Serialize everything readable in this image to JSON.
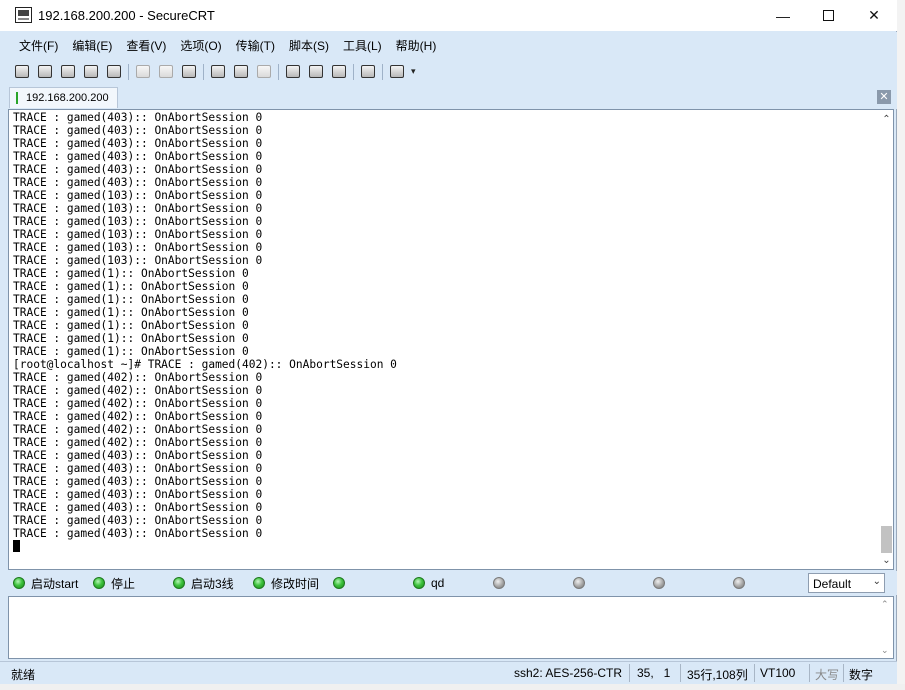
{
  "window": {
    "title": "192.168.200.200 - SecureCRT",
    "min_glyph": "—",
    "close_glyph": "✕"
  },
  "menu": [
    "文件(F)",
    "编辑(E)",
    "查看(V)",
    "选项(O)",
    "传输(T)",
    "脚本(S)",
    "工具(L)",
    "帮助(H)"
  ],
  "tab": {
    "label": "192.168.200.200",
    "close_glyph": "✕"
  },
  "terminal": {
    "lines": [
      "TRACE : gamed(403):: OnAbortSession 0",
      "TRACE : gamed(403):: OnAbortSession 0",
      "TRACE : gamed(403):: OnAbortSession 0",
      "TRACE : gamed(403):: OnAbortSession 0",
      "TRACE : gamed(403):: OnAbortSession 0",
      "TRACE : gamed(403):: OnAbortSession 0",
      "TRACE : gamed(103):: OnAbortSession 0",
      "TRACE : gamed(103):: OnAbortSession 0",
      "TRACE : gamed(103):: OnAbortSession 0",
      "TRACE : gamed(103):: OnAbortSession 0",
      "TRACE : gamed(103):: OnAbortSession 0",
      "TRACE : gamed(103):: OnAbortSession 0",
      "TRACE : gamed(1):: OnAbortSession 0",
      "TRACE : gamed(1):: OnAbortSession 0",
      "TRACE : gamed(1):: OnAbortSession 0",
      "TRACE : gamed(1):: OnAbortSession 0",
      "TRACE : gamed(1):: OnAbortSession 0",
      "TRACE : gamed(1):: OnAbortSession 0",
      "TRACE : gamed(1):: OnAbortSession 0",
      "[root@localhost ~]# TRACE : gamed(402):: OnAbortSession 0",
      "TRACE : gamed(402):: OnAbortSession 0",
      "TRACE : gamed(402):: OnAbortSession 0",
      "TRACE : gamed(402):: OnAbortSession 0",
      "TRACE : gamed(402):: OnAbortSession 0",
      "TRACE : gamed(402):: OnAbortSession 0",
      "TRACE : gamed(402):: OnAbortSession 0",
      "TRACE : gamed(403):: OnAbortSession 0",
      "TRACE : gamed(403):: OnAbortSession 0",
      "TRACE : gamed(403):: OnAbortSession 0",
      "TRACE : gamed(403):: OnAbortSession 0",
      "TRACE : gamed(403):: OnAbortSession 0",
      "TRACE : gamed(403):: OnAbortSession 0",
      "TRACE : gamed(403):: OnAbortSession 0"
    ],
    "scroll_up_glyph": "⌃",
    "scroll_down_glyph": "⌄"
  },
  "button_bar": {
    "buttons": [
      {
        "label": "启动start",
        "state": "on"
      },
      {
        "label": "停止",
        "state": "on"
      },
      {
        "label": "启动3线",
        "state": "on"
      },
      {
        "label": "修改时间",
        "state": "on"
      },
      {
        "label": "",
        "state": "on"
      },
      {
        "label": "qd",
        "state": "on"
      },
      {
        "label": "",
        "state": "off"
      },
      {
        "label": "",
        "state": "off"
      },
      {
        "label": "",
        "state": "off"
      },
      {
        "label": "",
        "state": "off"
      }
    ],
    "session_select": "Default",
    "select_arrow_glyph": "⌄"
  },
  "status": {
    "ready": "就绪",
    "encryption": "ssh2: AES-256-CTR",
    "cursor_pos": "35,   1",
    "dimensions": "35行,108列",
    "emulation": "VT100",
    "caps": "大写",
    "num": "数字"
  },
  "colors": {
    "chrome": "#d9e8f7",
    "led_on": "#3dc23d",
    "led_off": "#a5a5a5"
  }
}
